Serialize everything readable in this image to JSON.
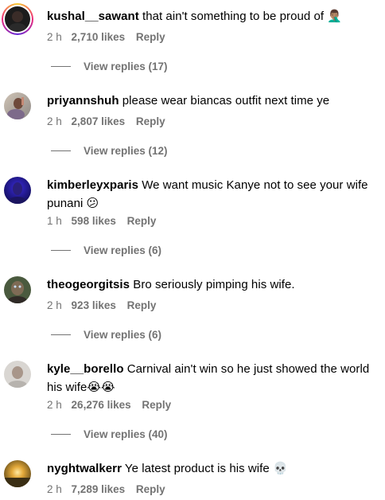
{
  "comments": [
    {
      "username": "kushal__sawant",
      "text": "that ain't something to be proud of 🤦🏽‍♂️",
      "time": "2 h",
      "likes": "2,710 likes",
      "reply": "Reply",
      "view_replies": "View replies (17)"
    },
    {
      "username": "priyannshuh",
      "text": "please wear biancas outfit next time ye",
      "time": "2 h",
      "likes": "2,807 likes",
      "reply": "Reply",
      "view_replies": "View replies (12)"
    },
    {
      "username": "kimberleyxparis",
      "text": "We want music Kanye not to see your wife punani 😕",
      "time": "1 h",
      "likes": "598 likes",
      "reply": "Reply",
      "view_replies": "View replies (6)"
    },
    {
      "username": "theogeorgitsis",
      "text": "Bro seriously pimping his wife.",
      "time": "2 h",
      "likes": "923 likes",
      "reply": "Reply",
      "view_replies": "View replies (6)"
    },
    {
      "username": "kyle__borello",
      "text": "Carnival ain't win so he just showed the world his wife😭😭",
      "time": "2 h",
      "likes": "26,276 likes",
      "reply": "Reply",
      "view_replies": "View replies (40)"
    },
    {
      "username": "nyghtwalkerr",
      "text": "Ye latest product is his wife 💀",
      "time": "2 h",
      "likes": "7,289 likes",
      "reply": "Reply"
    }
  ]
}
